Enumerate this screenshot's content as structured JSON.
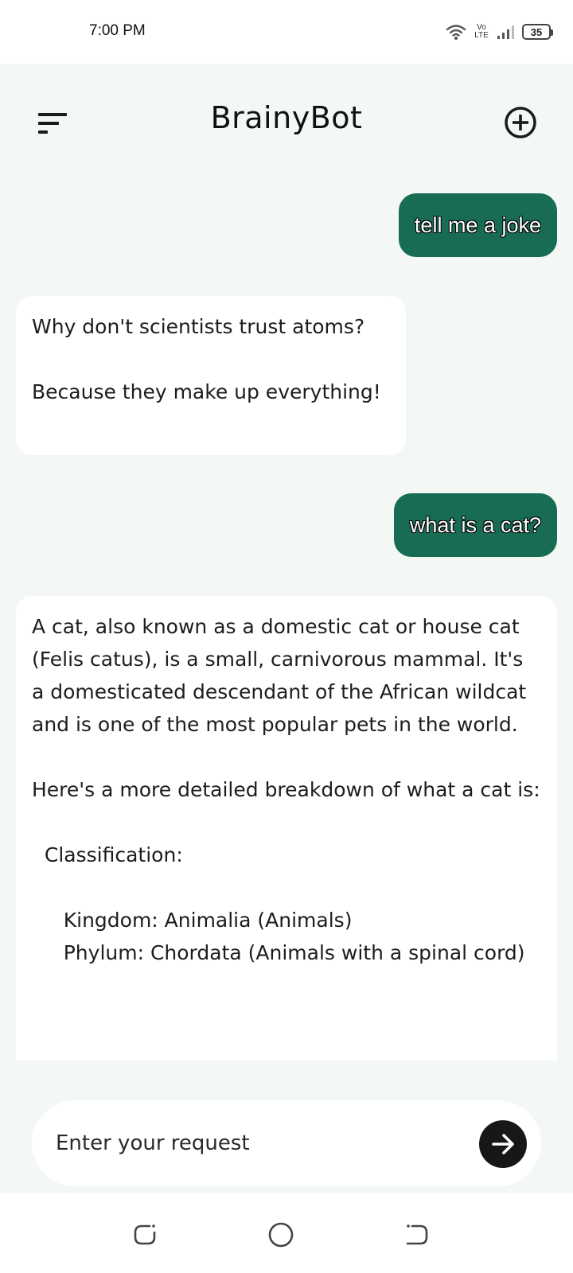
{
  "status_bar": {
    "time": "7:00 PM",
    "network": "Vo LTE",
    "battery": "35"
  },
  "header": {
    "title": "BrainyBot",
    "menu_icon": "menu-sort-icon",
    "new_chat_icon": "plus-circle-icon"
  },
  "messages": [
    {
      "role": "user",
      "text": "tell me a joke"
    },
    {
      "role": "bot",
      "text": "Why don't scientists trust atoms?\n\nBecause they make up everything!\n"
    },
    {
      "role": "user",
      "text": "what is a cat?"
    },
    {
      "role": "bot",
      "text": "A cat, also known as a domestic cat or house cat (Felis catus), is a small, carnivorous mammal. It's a domesticated descendant of the African wildcat and is one of the most popular pets in the world.\n\nHere's a more detailed breakdown of what a cat is:\n\n  Classification:\n\n     Kingdom: Animalia (Animals)\n     Phylum: Chordata (Animals with a spinal cord)"
    }
  ],
  "input": {
    "placeholder": "Enter your request",
    "value": "",
    "send_icon": "arrow-right-icon"
  },
  "nav_bar": {
    "recents_icon": "recents-icon",
    "home_icon": "home-circle-icon",
    "back_icon": "back-icon"
  },
  "colors": {
    "accent": "#186c54",
    "background": "#f3f8f4",
    "send_button": "#171717"
  }
}
